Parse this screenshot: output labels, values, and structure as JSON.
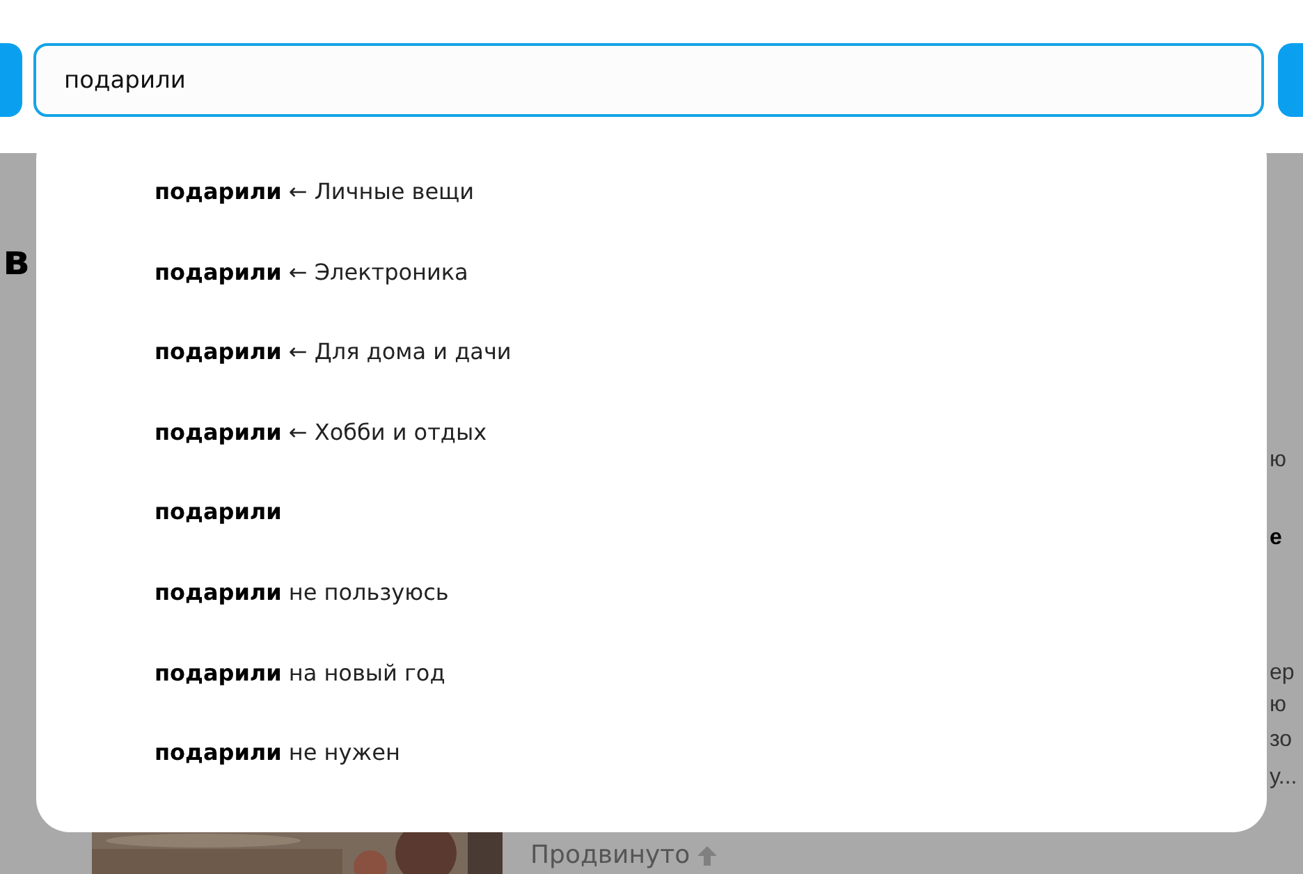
{
  "search": {
    "value": "подарили"
  },
  "suggestions": [
    {
      "query": "подарили",
      "rest": "← Личные вещи"
    },
    {
      "query": "подарили",
      "rest": "← Электроника"
    },
    {
      "query": "подарили",
      "rest": "← Для дома и дачи"
    },
    {
      "query": "подарили",
      "rest": "← Хобби и отдых"
    },
    {
      "query": "подарили"
    },
    {
      "query": "подарили",
      "rest": "не пользуюсь"
    },
    {
      "query": "подарили",
      "rest": "на новый год"
    },
    {
      "query": "подарили",
      "rest": "не нужен"
    }
  ],
  "page": {
    "heading": "в",
    "right_fragments": [
      {
        "text": "ю",
        "bold": false
      },
      {
        "text": "е",
        "bold": true
      },
      {
        "text": "ер",
        "bold": false
      },
      {
        "text": "ю",
        "bold": false
      },
      {
        "text": "зо",
        "bold": false
      },
      {
        "text": "у...",
        "bold": false
      }
    ],
    "promoted": "Продвинуто"
  }
}
